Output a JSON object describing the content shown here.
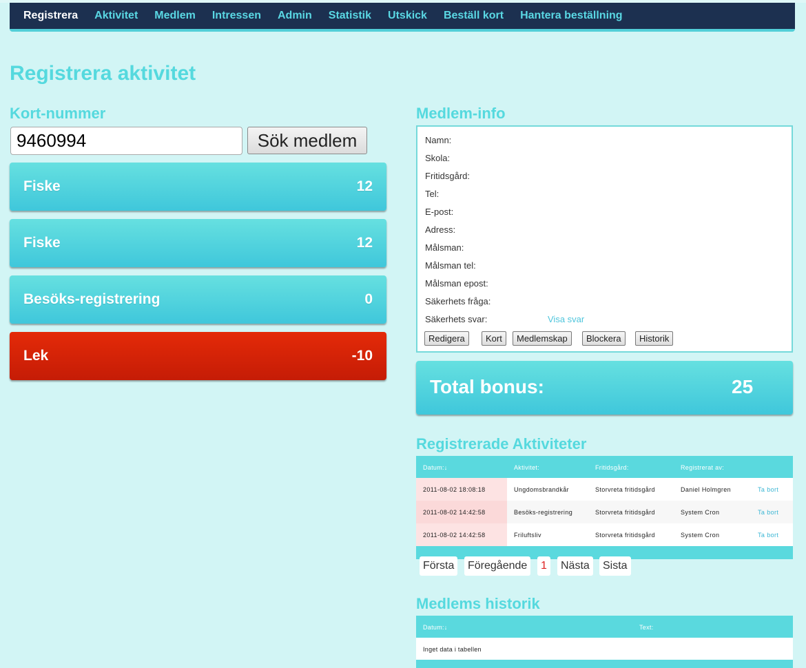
{
  "nav": {
    "items": [
      "Registrera",
      "Aktivitet",
      "Medlem",
      "Intressen",
      "Admin",
      "Statistik",
      "Utskick",
      "Beställ kort",
      "Hantera beställning"
    ]
  },
  "page": {
    "title": "Registrera aktivitet"
  },
  "card": {
    "heading": "Kort-nummer",
    "value": "9460994",
    "search_label": "Sök medlem"
  },
  "activities": [
    {
      "name": "Fiske",
      "points": "12",
      "color": "teal"
    },
    {
      "name": "Fiske",
      "points": "12",
      "color": "teal"
    },
    {
      "name": "Besöks-registrering",
      "points": "0",
      "color": "teal"
    },
    {
      "name": "Lek",
      "points": "-10",
      "color": "red"
    }
  ],
  "member_info": {
    "heading": "Medlem-info",
    "fields": [
      "Namn:",
      "Skola:",
      "Fritidsgård:",
      "Tel:",
      "E-post:",
      "Adress:",
      "Målsman:",
      "Målsman tel:",
      "Målsman epost:",
      "Säkerhets fråga:",
      "Säkerhets svar:"
    ],
    "show_answer": "Visa svar",
    "buttons": [
      "Redigera",
      "Kort",
      "Medlemskap",
      "Blockera",
      "Historik"
    ]
  },
  "bonus": {
    "label": "Total bonus:",
    "value": "25"
  },
  "registered": {
    "heading": "Registrerade Aktiviteter",
    "columns": [
      "Datum:↓",
      "Aktivitet:",
      "Fritidsgård:",
      "Registrerat av:"
    ],
    "rows": [
      {
        "date": "2011-08-02 18:08:18",
        "activity": "Ungdomsbrandkår",
        "center": "Storvreta fritidsgård",
        "by": "Daniel Holmgren",
        "action": "Ta bort"
      },
      {
        "date": "2011-08-02 14:42:58",
        "activity": "Besöks-registrering",
        "center": "Storvreta fritidsgård",
        "by": "System Cron",
        "action": "Ta bort"
      },
      {
        "date": "2011-08-02 14:42:58",
        "activity": "Friluftsliv",
        "center": "Storvreta fritidsgård",
        "by": "System Cron",
        "action": "Ta bort"
      }
    ],
    "pager": {
      "first": "Första",
      "prev": "Föregående",
      "current": "1",
      "next": "Nästa",
      "last": "Sista"
    }
  },
  "history": {
    "heading": "Medlems historik",
    "columns": [
      "Datum:↓",
      "Text:"
    ],
    "empty": "Inget data i tabellen"
  }
}
